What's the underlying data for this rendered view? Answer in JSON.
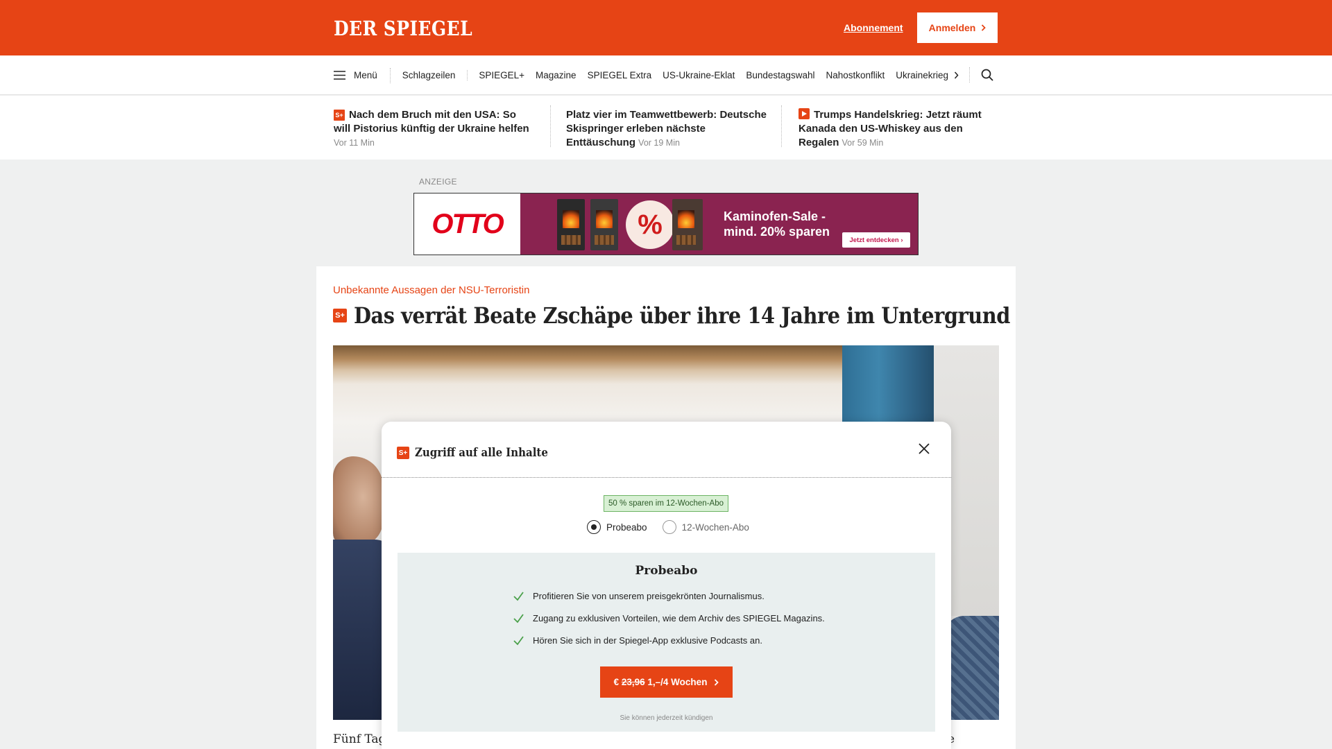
{
  "header": {
    "logo": "DER SPIEGEL",
    "subscription_link": "Abonnement",
    "login_label": "Anmelden",
    "brand_color": "#e64415"
  },
  "nav": {
    "menu_label": "Menü",
    "items": [
      "Schlagzeilen",
      "SPIEGEL+",
      "Magazine",
      "SPIEGEL Extra",
      "US-Ukraine-Eklat",
      "Bundestagswahl",
      "Nahostkonflikt",
      "Ukrainekrieg"
    ],
    "more_icon": "chevron-right-icon",
    "search_icon": "search-icon"
  },
  "teasers": [
    {
      "badge": "S+",
      "title": "Nach dem Bruch mit den USA: So will Pistorius künftig der Ukraine helfen",
      "time": "Vor 11 Min"
    },
    {
      "badge": "",
      "title": "Platz vier im Teamwettbewerb: Deutsche Skispringer erleben nächste Enttäuschung",
      "time": "Vor 19 Min"
    },
    {
      "badge": "play",
      "title": "Trumps Handelskrieg: Jetzt räumt Kanada den US-Whiskey aus den Regalen",
      "time": "Vor 59 Min"
    }
  ],
  "ad": {
    "label": "ANZEIGE",
    "brand": "OTTO",
    "badge": "%",
    "headline_line1": "Kaminofen-Sale -",
    "headline_line2": "mind. 20% sparen",
    "cta": "Jetzt entdecken"
  },
  "article": {
    "kicker": "Unbekannte Aussagen der NSU-Terroristin",
    "badge": "S+",
    "headline": "Das verrät Beate Zschäpe über ihre 14 Jahre im Untergrund",
    "lead_start": "Fünf Tag",
    "lead_end": "e"
  },
  "modal": {
    "badge": "S+",
    "title": "Zugriff auf alle Inhalte",
    "savings_badge": "50 % sparen im 12-Wochen-Abo",
    "options": [
      {
        "label": "Probeabo",
        "selected": true
      },
      {
        "label": "12-Wochen-Abo",
        "selected": false
      }
    ],
    "offer_title": "Probeabo",
    "features": [
      "Profitieren Sie von unserem preisgekrönten Journalismus.",
      "Zugang zu exklusiven Vorteilen, wie dem Archiv des SPIEGEL Magazins.",
      "Hören Sie sich in der Spiegel-App exklusive Podcasts an."
    ],
    "cta_currency": "€",
    "cta_old_price": "23,96",
    "cta_price": "1,–/4 Wochen",
    "cancel_note": "Sie können jederzeit kündigen",
    "check_color": "#4aa04a"
  }
}
